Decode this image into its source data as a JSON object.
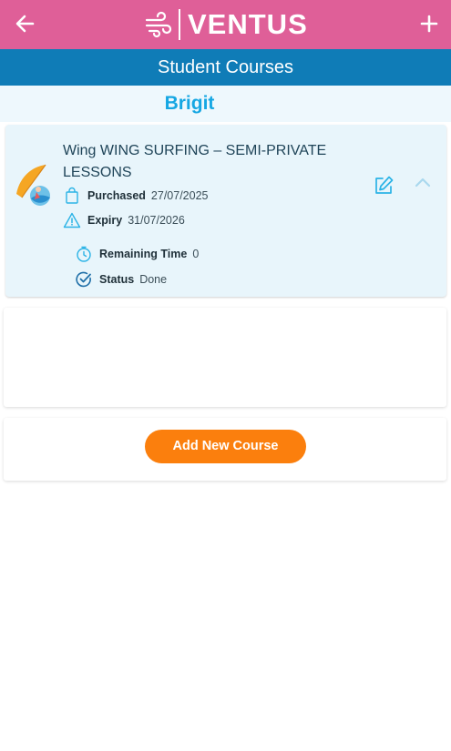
{
  "header": {
    "brand": "VENTUS",
    "back_icon": "arrow-left-icon",
    "add_icon": "plus-icon",
    "logo_icon": "wind-icon",
    "color": "#df5f98"
  },
  "page": {
    "title": "Student Courses",
    "title_bar_color": "#0f7cb7"
  },
  "student": {
    "name": "Brigit"
  },
  "course": {
    "title": "Wing WING SURFING – SEMI-PRIVATE LESSONS",
    "icon": "wing-surfing-icon",
    "purchased_label": "Purchased",
    "purchased_value": "27/07/2025",
    "expiry_label": "Expiry",
    "expiry_value": "31/07/2026",
    "remaining_label": "Remaining Time",
    "remaining_value": "0",
    "status_label": "Status",
    "status_value": "Done",
    "edit_icon": "edit-icon",
    "collapse_icon": "chevron-up-icon"
  },
  "actions": {
    "add_course_label": "Add New Course",
    "accent": "#fb7f0d"
  }
}
